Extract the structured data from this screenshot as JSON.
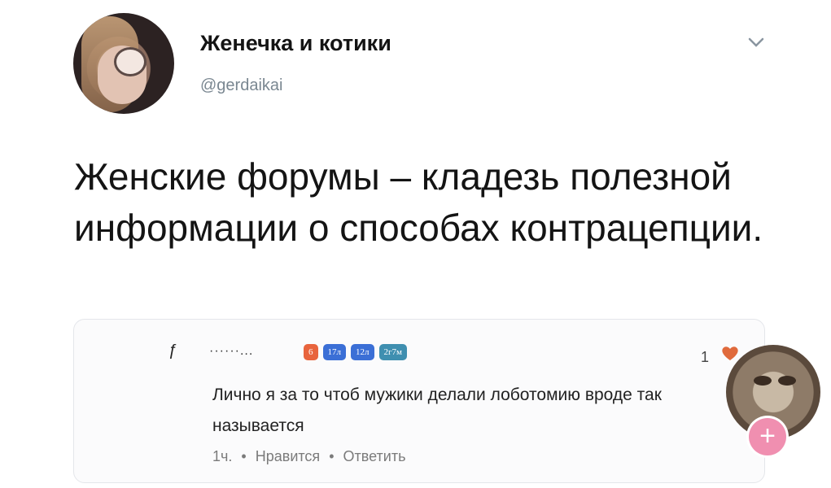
{
  "tweet": {
    "author_name": "Женечка и котики",
    "handle": "@gerdaikai",
    "text": "Женские форумы – кладезь полезной информации о способах контрацепции."
  },
  "embedded_comment": {
    "masked_name": "······...",
    "badges": [
      "6",
      "17л",
      "12л",
      "2г7м"
    ],
    "like_count": "1",
    "text": "Лично я за то чтоб мужики делали лоботомию вроде так называется",
    "time": "1ч.",
    "separator": "•",
    "like_label": "Нравится",
    "reply_label": "Ответить"
  },
  "overlay": {
    "plus_label": "+"
  },
  "colors": {
    "handle": "#7a8791",
    "badge_orange": "#e8643d",
    "badge_blue": "#3b6fd6",
    "heart": "#e06a3c",
    "plus": "#f08fb0"
  },
  "icons": {
    "chevron": "chevron-down-icon",
    "heart": "heart-icon"
  }
}
